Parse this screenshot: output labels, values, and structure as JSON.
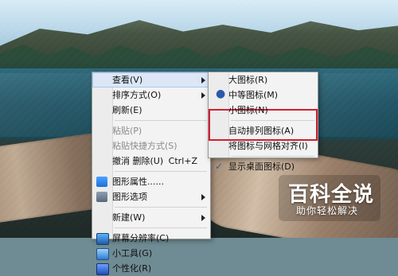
{
  "desktop": {
    "watermark": {
      "main": "百科全说",
      "sub": "助你轻松解决"
    }
  },
  "context_menu": {
    "items": [
      {
        "label": "查看(V)",
        "type": "item",
        "submenu": true,
        "selected": true,
        "icon": null
      },
      {
        "label": "排序方式(O)",
        "type": "item",
        "submenu": true,
        "icon": null
      },
      {
        "label": "刷新(E)",
        "type": "item",
        "icon": null
      },
      {
        "type": "separator"
      },
      {
        "label": "粘贴(P)",
        "type": "item",
        "disabled": true,
        "icon": null
      },
      {
        "label": "粘贴快捷方式(S)",
        "type": "item",
        "disabled": true,
        "icon": null
      },
      {
        "label": "撤消 删除(U)",
        "type": "item",
        "shortcut": "Ctrl+Z",
        "icon": null
      },
      {
        "type": "separator"
      },
      {
        "label": "图形属性......",
        "type": "item",
        "icon": "graphics-properties-icon"
      },
      {
        "label": "图形选项",
        "type": "item",
        "submenu": true,
        "icon": "graphics-options-icon"
      },
      {
        "type": "separator"
      },
      {
        "label": "新建(W)",
        "type": "item",
        "submenu": true,
        "icon": null
      },
      {
        "type": "separator"
      },
      {
        "label": "屏幕分辨率(C)",
        "type": "item",
        "icon": "screen-resolution-icon"
      },
      {
        "label": "小工具(G)",
        "type": "item",
        "icon": "gadgets-icon"
      },
      {
        "label": "个性化(R)",
        "type": "item",
        "icon": "personalize-icon"
      }
    ]
  },
  "view_submenu": {
    "items": [
      {
        "label": "大图标(R)",
        "type": "item"
      },
      {
        "label": "中等图标(M)",
        "type": "item",
        "radio": true
      },
      {
        "label": "小图标(N)",
        "type": "item"
      },
      {
        "type": "separator"
      },
      {
        "label": "自动排列图标(A)",
        "type": "item"
      },
      {
        "label": "将图标与网格对齐(I)",
        "type": "item"
      },
      {
        "type": "separator"
      },
      {
        "label": "显示桌面图标(D)",
        "type": "item",
        "checked": true
      }
    ],
    "highlight": {
      "color": "#d11f2f"
    }
  }
}
